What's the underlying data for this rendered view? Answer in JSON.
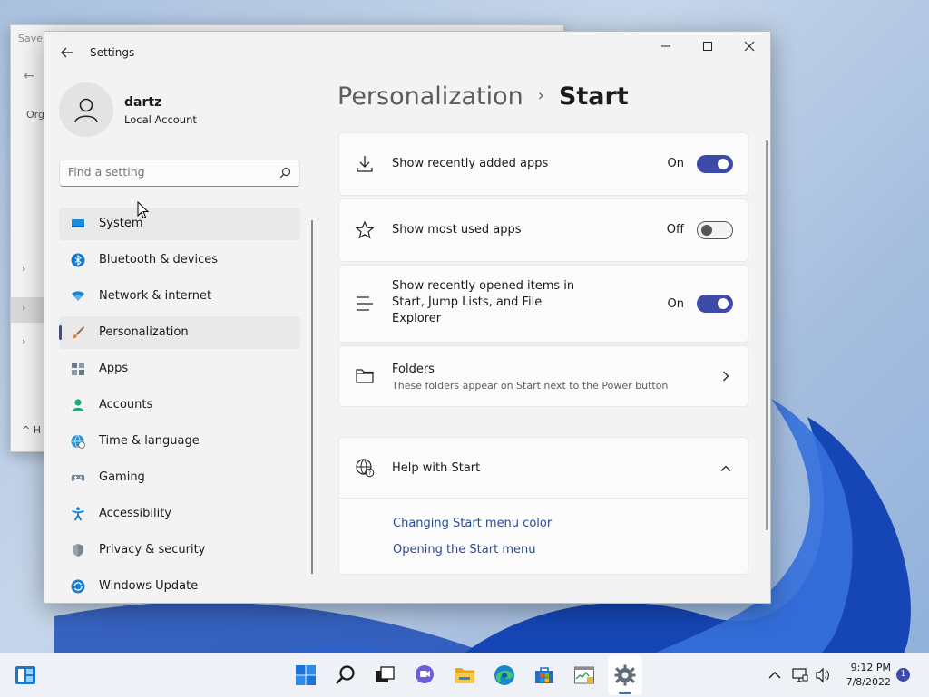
{
  "background_window": {
    "title": "Save",
    "org_label": "Org",
    "footer_label": "H"
  },
  "window": {
    "title": "Settings"
  },
  "user": {
    "name": "dartz",
    "account_type": "Local Account"
  },
  "search": {
    "placeholder": "Find a setting"
  },
  "sidebar": {
    "items": [
      {
        "label": "System",
        "icon": "system-icon"
      },
      {
        "label": "Bluetooth & devices",
        "icon": "bluetooth-icon"
      },
      {
        "label": "Network & internet",
        "icon": "wifi-icon"
      },
      {
        "label": "Personalization",
        "icon": "brush-icon",
        "selected": true
      },
      {
        "label": "Apps",
        "icon": "apps-icon"
      },
      {
        "label": "Accounts",
        "icon": "person-icon"
      },
      {
        "label": "Time & language",
        "icon": "globe-clock-icon"
      },
      {
        "label": "Gaming",
        "icon": "gamepad-icon"
      },
      {
        "label": "Accessibility",
        "icon": "accessibility-icon"
      },
      {
        "label": "Privacy & security",
        "icon": "shield-icon"
      },
      {
        "label": "Windows Update",
        "icon": "update-icon"
      }
    ]
  },
  "breadcrumb": {
    "parent": "Personalization",
    "separator": "›",
    "current": "Start"
  },
  "settings": {
    "recently_added": {
      "label": "Show recently added apps",
      "state": "On",
      "on": true
    },
    "most_used": {
      "label": "Show most used apps",
      "state": "Off",
      "on": false
    },
    "recently_opened": {
      "label_line1": "Show recently opened items in",
      "label_line2": "Start, Jump Lists, and File",
      "label_line3": "Explorer",
      "state": "On",
      "on": true
    },
    "folders": {
      "label": "Folders",
      "description": "These folders appear on Start next to the Power button"
    }
  },
  "help": {
    "title": "Help with Start",
    "links": [
      "Changing Start menu color",
      "Opening the Start menu"
    ]
  },
  "taskbar": {
    "time": "9:12 PM",
    "date": "7/8/2022",
    "notifications": "1"
  },
  "colors": {
    "accent": "#3d4aa8",
    "link": "#2b4a96"
  }
}
